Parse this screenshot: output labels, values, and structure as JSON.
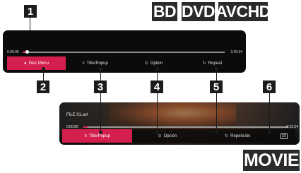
{
  "badges": {
    "bd": "BD",
    "dvd": "DVD",
    "avchd": "AVCHD",
    "movie": "MOVIE"
  },
  "callouts": [
    "1",
    "2",
    "3",
    "4",
    "5",
    "6"
  ],
  "panel1": {
    "time_start": "0:00:00",
    "time_end": "3:26:34",
    "progress": 0.02,
    "buttons": [
      {
        "icon": "circle-dot-icon",
        "glyph": "●",
        "label": "Disc Menu",
        "selected": true
      },
      {
        "icon": "list-icon",
        "glyph": "≡",
        "label": "Title/Popup",
        "selected": false
      },
      {
        "icon": "option-icon",
        "glyph": "⊙",
        "label": "Option",
        "selected": false
      },
      {
        "icon": "repeat-icon",
        "glyph": "↻",
        "label": "Repeat",
        "selected": false
      }
    ]
  },
  "panel2": {
    "file_name": "FILE 01.avi",
    "time_start": "0:00:00",
    "time_end": "0:22:34",
    "progress": 0.02,
    "buttons": [
      {
        "icon": "list-icon",
        "glyph": "≡",
        "label": "Title/Popup",
        "selected": true
      },
      {
        "icon": "option-icon",
        "glyph": "⊙",
        "label": "Opción",
        "selected": false
      },
      {
        "icon": "repeat-icon",
        "glyph": "↻",
        "label": "Repetición",
        "selected": false
      },
      {
        "icon": "3d-icon",
        "glyph": "3D",
        "label": "",
        "selected": false
      }
    ]
  },
  "colors": {
    "accent": "#d41f4e",
    "panel": "#0b0b0b",
    "callout": "#1c1c1c"
  }
}
